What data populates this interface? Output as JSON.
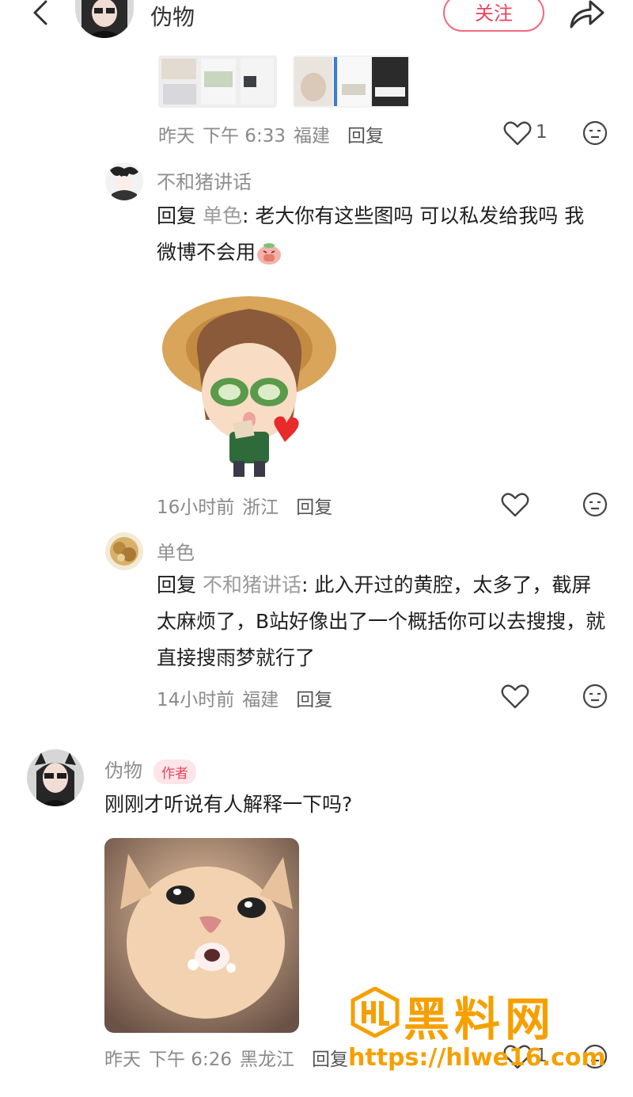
{
  "header": {
    "title": "伪物",
    "follow_label": "关注"
  },
  "comments": [
    {
      "time": "昨天",
      "period": "下午 6:33",
      "location": "福建",
      "reply_label": "回复",
      "likes": "1"
    },
    {
      "username": "不和猪讲话",
      "reply_prefix": "回复",
      "reply_to": "单色",
      "text": ": 老大你有这些图吗 可以私发给我吗 我微博不会用",
      "time": "16小时前",
      "location": "浙江",
      "reply_label": "回复"
    },
    {
      "username": "单色",
      "reply_prefix": "回复",
      "reply_to": "不和猪讲话",
      "text": ": 此入开过的黄腔，太多了，截屏太麻烦了，B站好像出了一个概括你可以去搜搜，就直接搜雨梦就行了",
      "time": "14小时前",
      "location": "福建",
      "reply_label": "回复"
    },
    {
      "username": "伪物",
      "badge": "作者",
      "text": "刚刚才听说有人解释一下吗?",
      "time": "昨天",
      "period": "下午 6:26",
      "location": "黑龙江",
      "reply_label": "回复",
      "likes": "1"
    }
  ],
  "watermark": {
    "title": "黑料网",
    "url": "https://hlwe16.com"
  },
  "colors": {
    "accent": "#e8455e",
    "watermark": "#f5a000",
    "meta": "#8a8a8a"
  }
}
